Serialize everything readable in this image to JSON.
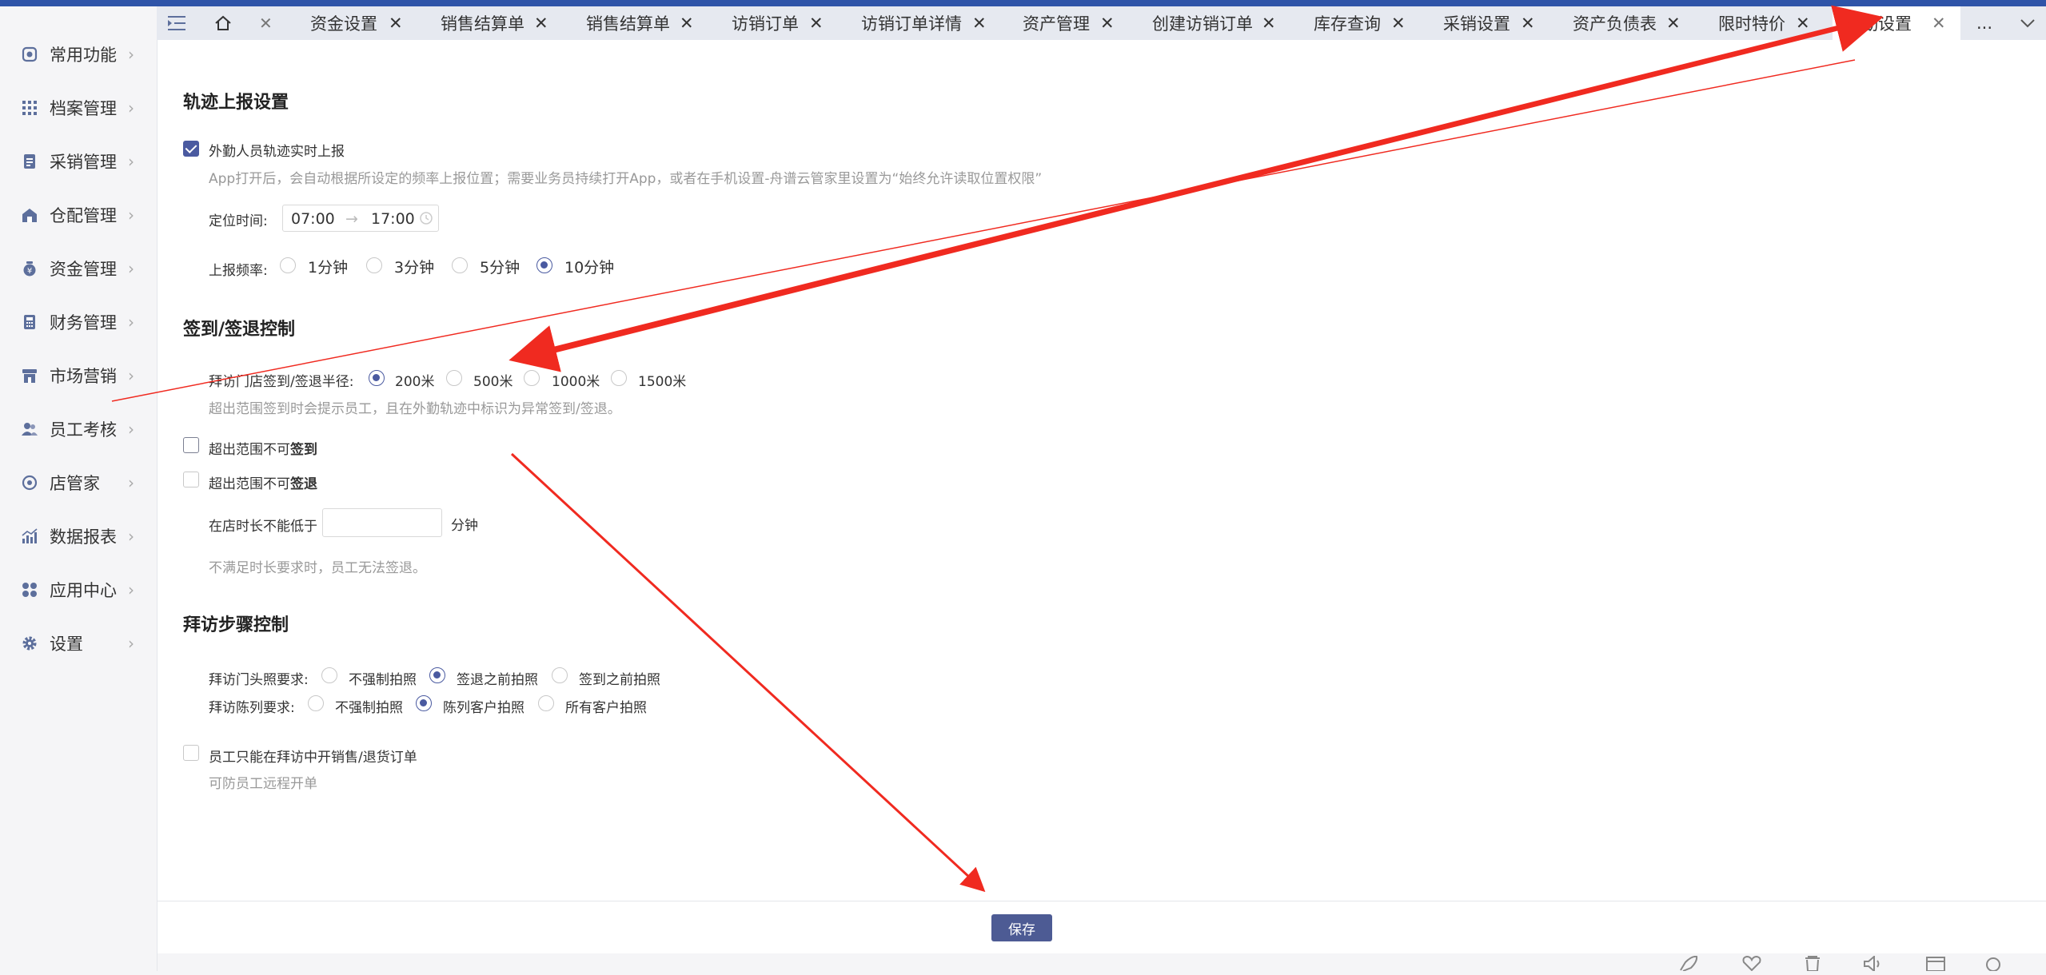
{
  "sidebar": {
    "items": [
      {
        "label": "常用功能",
        "icon": "common-icon"
      },
      {
        "label": "档案管理",
        "icon": "archive-icon"
      },
      {
        "label": "采销管理",
        "icon": "purchase-icon"
      },
      {
        "label": "仓配管理",
        "icon": "warehouse-icon"
      },
      {
        "label": "资金管理",
        "icon": "funds-icon"
      },
      {
        "label": "财务管理",
        "icon": "finance-icon"
      },
      {
        "label": "市场营销",
        "icon": "marketing-icon"
      },
      {
        "label": "员工考核",
        "icon": "staff-icon"
      },
      {
        "label": "店管家",
        "icon": "store-icon"
      },
      {
        "label": "数据报表",
        "icon": "report-icon"
      },
      {
        "label": "应用中心",
        "icon": "apps-icon"
      },
      {
        "label": "设置",
        "icon": "gear-icon"
      }
    ]
  },
  "tabs": {
    "items": [
      "资金设置",
      "销售结算单",
      "销售结算单",
      "访销订单",
      "访销订单详情",
      "资产管理",
      "创建访销订单",
      "库存查询",
      "采销设置",
      "资产负债表",
      "限时特价",
      "勤设置"
    ],
    "active": 11,
    "more": "..."
  },
  "track": {
    "title": "轨迹上报设置",
    "realtime_label": "外勤人员轨迹实时上报",
    "realtime_checked": true,
    "realtime_hint": "App打开后，会自动根据所设定的频率上报位置；需要业务员持续打开App，或者在手机设置-舟谱云管家里设置为“始终允许读取位置权限”",
    "time_label": "定位时间:",
    "time_start": "07:00",
    "time_sep": "→",
    "time_end": "17:00",
    "freq_label": "上报频率:",
    "freq_options": [
      "1分钟",
      "3分钟",
      "5分钟",
      "10分钟"
    ],
    "freq_selected": 3
  },
  "checkin": {
    "title": "签到/签退控制",
    "radius_label": "拜访门店签到/签退半径:",
    "radius_options": [
      "200米",
      "500米",
      "1000米",
      "1500米"
    ],
    "radius_selected": 0,
    "radius_hint": "超出范围签到时会提示员工，且在外勤轨迹中标识为异常签到/签退。",
    "no_checkin_prefix": "超出范围不可",
    "no_checkin_bold": "签到",
    "no_checkout_prefix": "超出范围不可",
    "no_checkout_bold": "签退",
    "min_duration_label": "在店时长不能低于",
    "min_duration_value": "",
    "min_duration_unit": "分钟",
    "min_duration_hint": "不满足时长要求时，员工无法签退。"
  },
  "steps": {
    "title": "拜访步骤控制",
    "door_photo_label": "拜访门头照要求:",
    "door_photo_options": [
      "不强制拍照",
      "签退之前拍照",
      "签到之前拍照"
    ],
    "door_photo_selected": 1,
    "display_label": "拜访陈列要求:",
    "display_options": [
      "不强制拍照",
      "陈列客户拍照",
      "所有客户拍照"
    ],
    "display_selected": 1,
    "order_only_label": "员工只能在拜访中开销售/退货订单",
    "order_only_hint": "可防员工远程开单"
  },
  "footer": {
    "save_label": "保存"
  },
  "colors": {
    "accent": "#4a5aa0",
    "topbar": "#2f54a8",
    "annotation": "#f02a20"
  }
}
